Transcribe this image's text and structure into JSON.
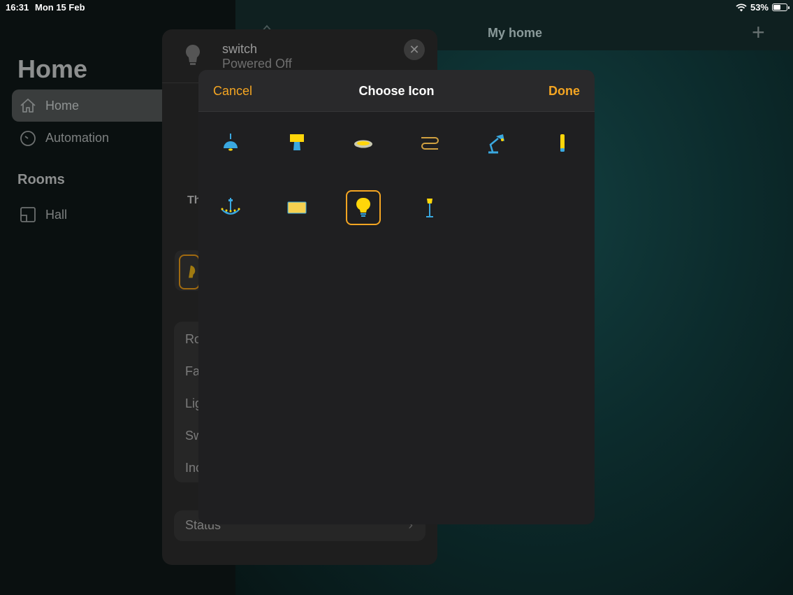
{
  "status_bar": {
    "time": "16:31",
    "date": "Mon 15 Feb",
    "battery": "53%"
  },
  "sidebar": {
    "title": "Home",
    "items": [
      {
        "label": "Home",
        "icon": "house-icon",
        "active": true
      },
      {
        "label": "Automation",
        "icon": "clock-icon",
        "active": false
      }
    ],
    "rooms_label": "Rooms",
    "rooms": [
      {
        "label": "Hall",
        "icon": "room-icon"
      }
    ]
  },
  "header": {
    "title": "My home",
    "add_icon": "plus-icon"
  },
  "accessory": {
    "name": "switch",
    "status": "Powered Off",
    "truncated_label": "Th",
    "list_rows": [
      "Ro",
      "Fa",
      "Lig",
      "Sw",
      "Inc"
    ],
    "status_row": "Status",
    "status_chevron": "›"
  },
  "chooser": {
    "cancel": "Cancel",
    "title": "Choose Icon",
    "done": "Done",
    "icons": [
      {
        "name": "pendant-lamp-icon",
        "selected": false
      },
      {
        "name": "table-lamp-icon",
        "selected": false
      },
      {
        "name": "ceiling-light-icon",
        "selected": false
      },
      {
        "name": "light-strip-icon",
        "selected": false
      },
      {
        "name": "desk-lamp-icon",
        "selected": false
      },
      {
        "name": "wall-light-icon",
        "selected": false
      },
      {
        "name": "chandelier-icon",
        "selected": false
      },
      {
        "name": "light-panel-icon",
        "selected": false
      },
      {
        "name": "lightbulb-icon",
        "selected": true
      },
      {
        "name": "floor-lamp-icon",
        "selected": false
      }
    ]
  },
  "colors": {
    "accent": "#f4a522",
    "icon_blue": "#3aa8e0",
    "icon_yellow": "#ffd60a"
  }
}
